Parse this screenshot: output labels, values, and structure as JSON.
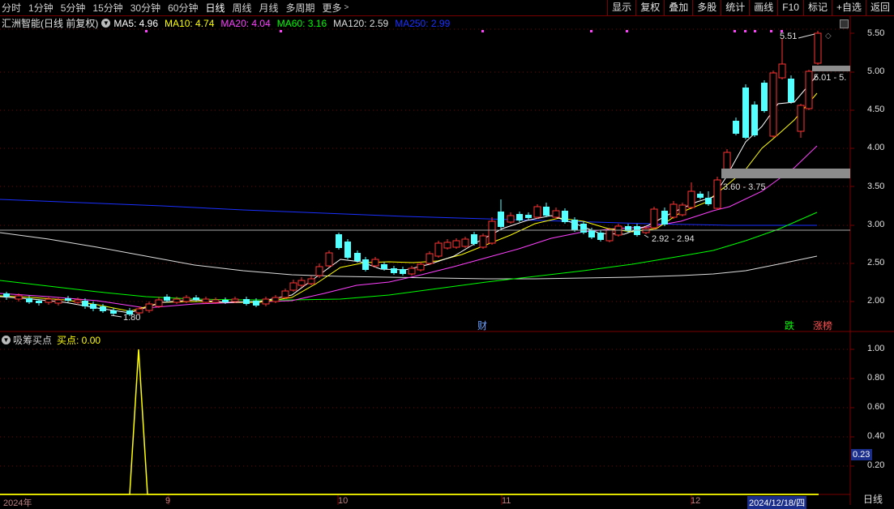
{
  "toolbar": {
    "periods": [
      "分时",
      "1分钟",
      "5分钟",
      "15分钟",
      "30分钟",
      "60分钟",
      "日线",
      "周线",
      "月线",
      "多周期",
      "更多"
    ],
    "active_period": "日线",
    "right_buttons": [
      "显示",
      "复权",
      "叠加",
      "多股",
      "统计",
      "画线",
      "F10",
      "标记",
      "+自选",
      "返回"
    ]
  },
  "info": {
    "title": "汇洲智能(日线 前复权)",
    "ma": [
      {
        "label": "MA5: 4.96",
        "color": "#ffffff"
      },
      {
        "label": "MA10: 4.74",
        "color": "#ffff00"
      },
      {
        "label": "MA20: 4.04",
        "color": "#ff40ff"
      },
      {
        "label": "MA60: 3.16",
        "color": "#00ff00"
      },
      {
        "label": "MA120: 2.59",
        "color": "#dddddd"
      },
      {
        "label": "MA250: 2.99",
        "color": "#1a30ff"
      }
    ]
  },
  "price_axis": [
    "5.50",
    "5.00",
    "4.50",
    "4.00",
    "3.50",
    "3.00",
    "2.50",
    "2.00"
  ],
  "indicator_axis": [
    "1.00",
    "0.80",
    "0.60",
    "0.40",
    "0.20"
  ],
  "annotations": {
    "high": "5.51",
    "low": "1.80",
    "range_top": "5.01 - 5.",
    "range_mid": "3.60 - 3.75",
    "range_low": "2.92 - 2.94"
  },
  "badges": {
    "cai": "财",
    "die": "跌",
    "zhangbang": "涨榜"
  },
  "indicator": {
    "name": "吸筹买点",
    "value_label": "买点: 0.00",
    "current_value": "0.23"
  },
  "x_axis": {
    "year": "2024年",
    "m9": "9",
    "m10": "10",
    "m11": "11",
    "m12": "12",
    "cursor_date": "2024/12/18/四"
  },
  "bottom_tab": "日线",
  "colors": {
    "up": "#ff3232",
    "down": "#54ffff",
    "grid": "#7a0000",
    "ma5": "#ffffff",
    "ma10": "#ffff00",
    "ma20": "#ff40ff",
    "ma60": "#00ff00",
    "ma120": "#dddddd",
    "ma250": "#1a30ff"
  }
}
